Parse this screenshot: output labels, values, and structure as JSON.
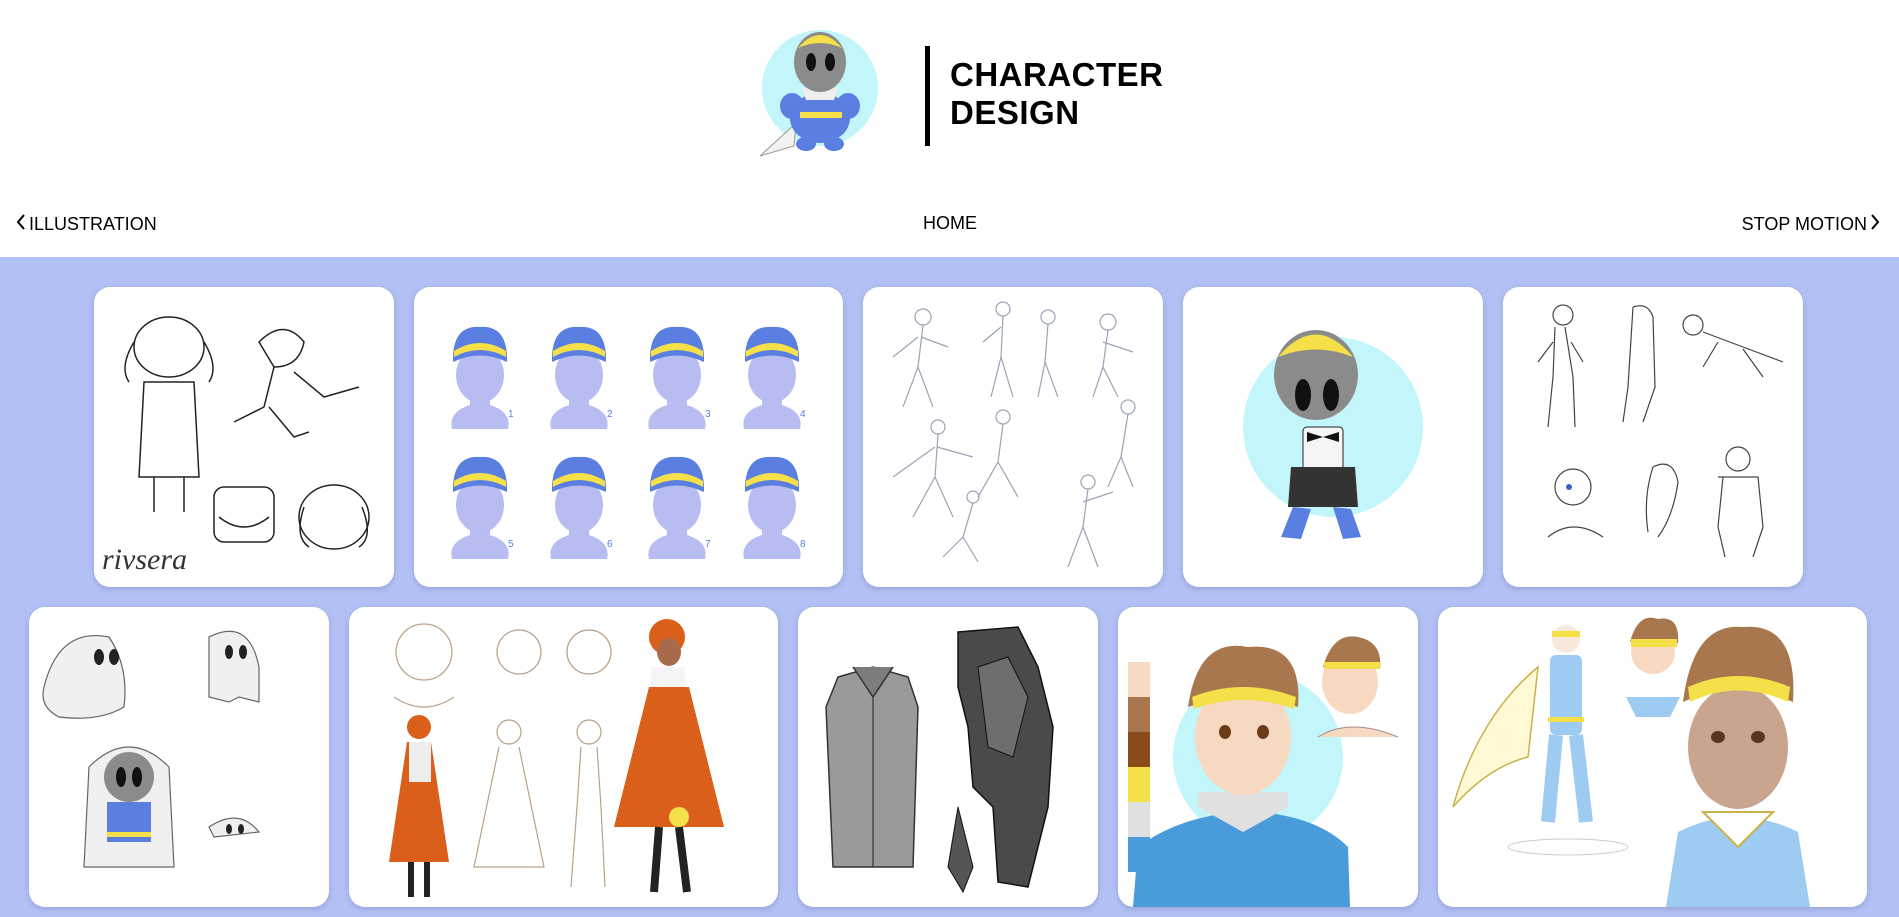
{
  "brand": {
    "line1": "CHARACTER",
    "line2": "DESIGN"
  },
  "nav": {
    "prev_label": "ILLUSTRATION",
    "home_label": "HOME",
    "next_label": "STOP MOTION"
  },
  "colors": {
    "gallery_bg": "#b3c0f4",
    "accent_blue": "#5b7fe0",
    "accent_yellow": "#f5e04a",
    "light_cyan": "#c2f6fb"
  },
  "gallery": {
    "row1": [
      {
        "name": "dog-character-sketch",
        "signature": "rivsera"
      },
      {
        "name": "hair-variations",
        "numbers": [
          "1",
          "2",
          "3",
          "4",
          "5",
          "6",
          "7",
          "8"
        ]
      },
      {
        "name": "pose-sketches"
      },
      {
        "name": "chibi-suspenders-character"
      },
      {
        "name": "figure-sketches"
      }
    ],
    "row2": [
      {
        "name": "ghost-character-sketches"
      },
      {
        "name": "orange-dress-character-sheet"
      },
      {
        "name": "armor-costume-sketch"
      },
      {
        "name": "boy-headband-color-study"
      },
      {
        "name": "caped-hero-turnaround"
      }
    ]
  }
}
